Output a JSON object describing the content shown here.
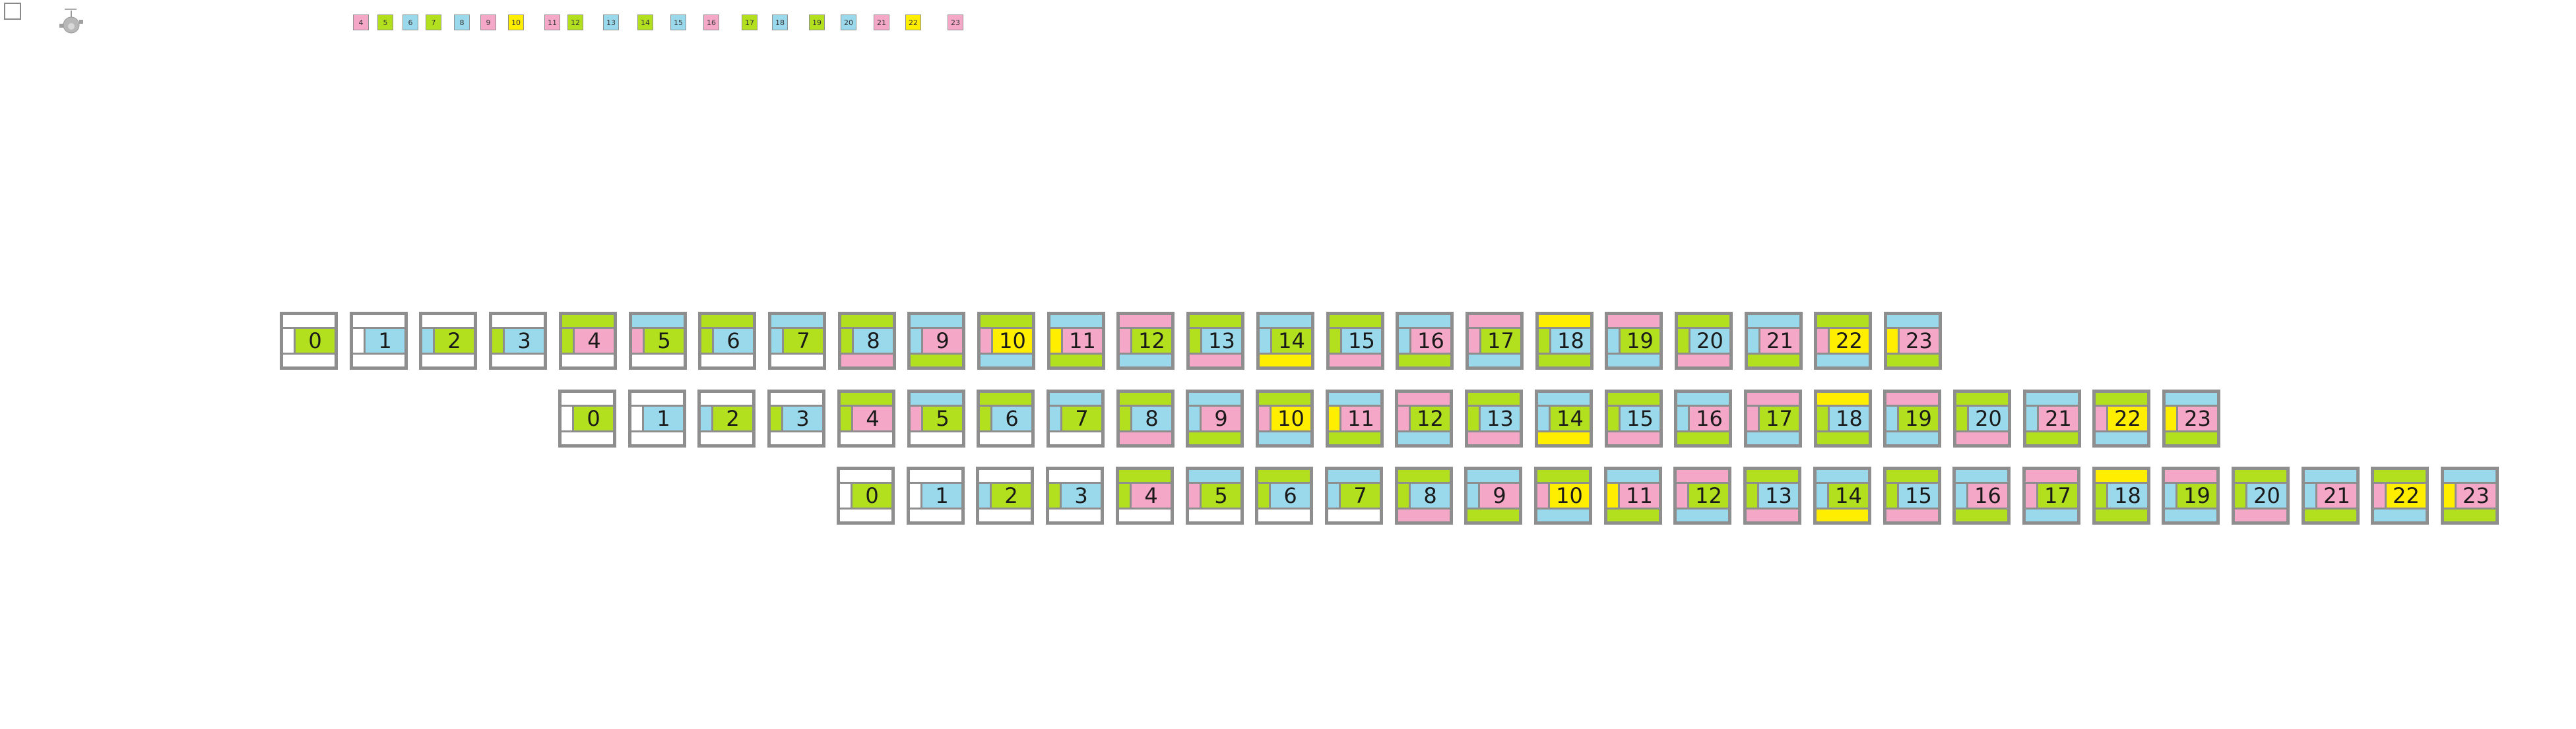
{
  "colors": {
    "pink": "#f4a7c6",
    "green": "#b3e01e",
    "blue": "#9ad9ec",
    "yellow": "#ffee00",
    "white": "#ffffff",
    "border": "#8e8e8e"
  },
  "tool_icon": "robot-toy-icon",
  "mini_tiles": [
    {
      "label": "4",
      "color": "pink"
    },
    {
      "label": "5",
      "color": "green"
    },
    {
      "label": "6",
      "color": "blue"
    },
    {
      "label": "7",
      "color": "green"
    },
    {
      "label": "8",
      "color": "blue"
    },
    {
      "label": "9",
      "color": "pink"
    },
    {
      "label": "10",
      "color": "yellow"
    },
    {
      "label": "11",
      "color": "pink"
    },
    {
      "label": "12",
      "color": "green"
    },
    {
      "label": "13",
      "color": "blue"
    },
    {
      "label": "14",
      "color": "green"
    },
    {
      "label": "15",
      "color": "blue"
    },
    {
      "label": "16",
      "color": "pink"
    },
    {
      "label": "17",
      "color": "green"
    },
    {
      "label": "18",
      "color": "blue"
    },
    {
      "label": "19",
      "color": "green"
    },
    {
      "label": "20",
      "color": "blue"
    },
    {
      "label": "21",
      "color": "pink"
    },
    {
      "label": "22",
      "color": "yellow"
    },
    {
      "label": "23",
      "color": "pink"
    }
  ],
  "tiles": [
    {
      "label": "0",
      "top": "white",
      "bottom": "white",
      "side": "white",
      "main": "green"
    },
    {
      "label": "1",
      "top": "white",
      "bottom": "white",
      "side": "white",
      "main": "blue"
    },
    {
      "label": "2",
      "top": "white",
      "bottom": "white",
      "side": "blue",
      "main": "green"
    },
    {
      "label": "3",
      "top": "white",
      "bottom": "white",
      "side": "green",
      "main": "blue"
    },
    {
      "label": "4",
      "top": "green",
      "bottom": "white",
      "side": "green",
      "main": "pink"
    },
    {
      "label": "5",
      "top": "blue",
      "bottom": "white",
      "side": "pink",
      "main": "green"
    },
    {
      "label": "6",
      "top": "green",
      "bottom": "white",
      "side": "green",
      "main": "blue"
    },
    {
      "label": "7",
      "top": "blue",
      "bottom": "white",
      "side": "blue",
      "main": "green"
    },
    {
      "label": "8",
      "top": "green",
      "bottom": "pink",
      "side": "green",
      "main": "blue"
    },
    {
      "label": "9",
      "top": "blue",
      "bottom": "green",
      "side": "blue",
      "main": "pink"
    },
    {
      "label": "10",
      "top": "green",
      "bottom": "blue",
      "side": "pink",
      "main": "yellow"
    },
    {
      "label": "11",
      "top": "blue",
      "bottom": "green",
      "side": "yellow",
      "main": "pink"
    },
    {
      "label": "12",
      "top": "pink",
      "bottom": "blue",
      "side": "pink",
      "main": "green"
    },
    {
      "label": "13",
      "top": "green",
      "bottom": "pink",
      "side": "green",
      "main": "blue"
    },
    {
      "label": "14",
      "top": "blue",
      "bottom": "yellow",
      "side": "blue",
      "main": "green"
    },
    {
      "label": "15",
      "top": "green",
      "bottom": "pink",
      "side": "green",
      "main": "blue"
    },
    {
      "label": "16",
      "top": "blue",
      "bottom": "green",
      "side": "blue",
      "main": "pink"
    },
    {
      "label": "17",
      "top": "pink",
      "bottom": "blue",
      "side": "pink",
      "main": "green"
    },
    {
      "label": "18",
      "top": "yellow",
      "bottom": "green",
      "side": "green",
      "main": "blue"
    },
    {
      "label": "19",
      "top": "pink",
      "bottom": "blue",
      "side": "blue",
      "main": "green"
    },
    {
      "label": "20",
      "top": "green",
      "bottom": "pink",
      "side": "green",
      "main": "blue"
    },
    {
      "label": "21",
      "top": "blue",
      "bottom": "green",
      "side": "blue",
      "main": "pink"
    },
    {
      "label": "22",
      "top": "green",
      "bottom": "blue",
      "side": "pink",
      "main": "yellow"
    },
    {
      "label": "23",
      "top": "blue",
      "bottom": "green",
      "side": "yellow",
      "main": "pink"
    }
  ]
}
